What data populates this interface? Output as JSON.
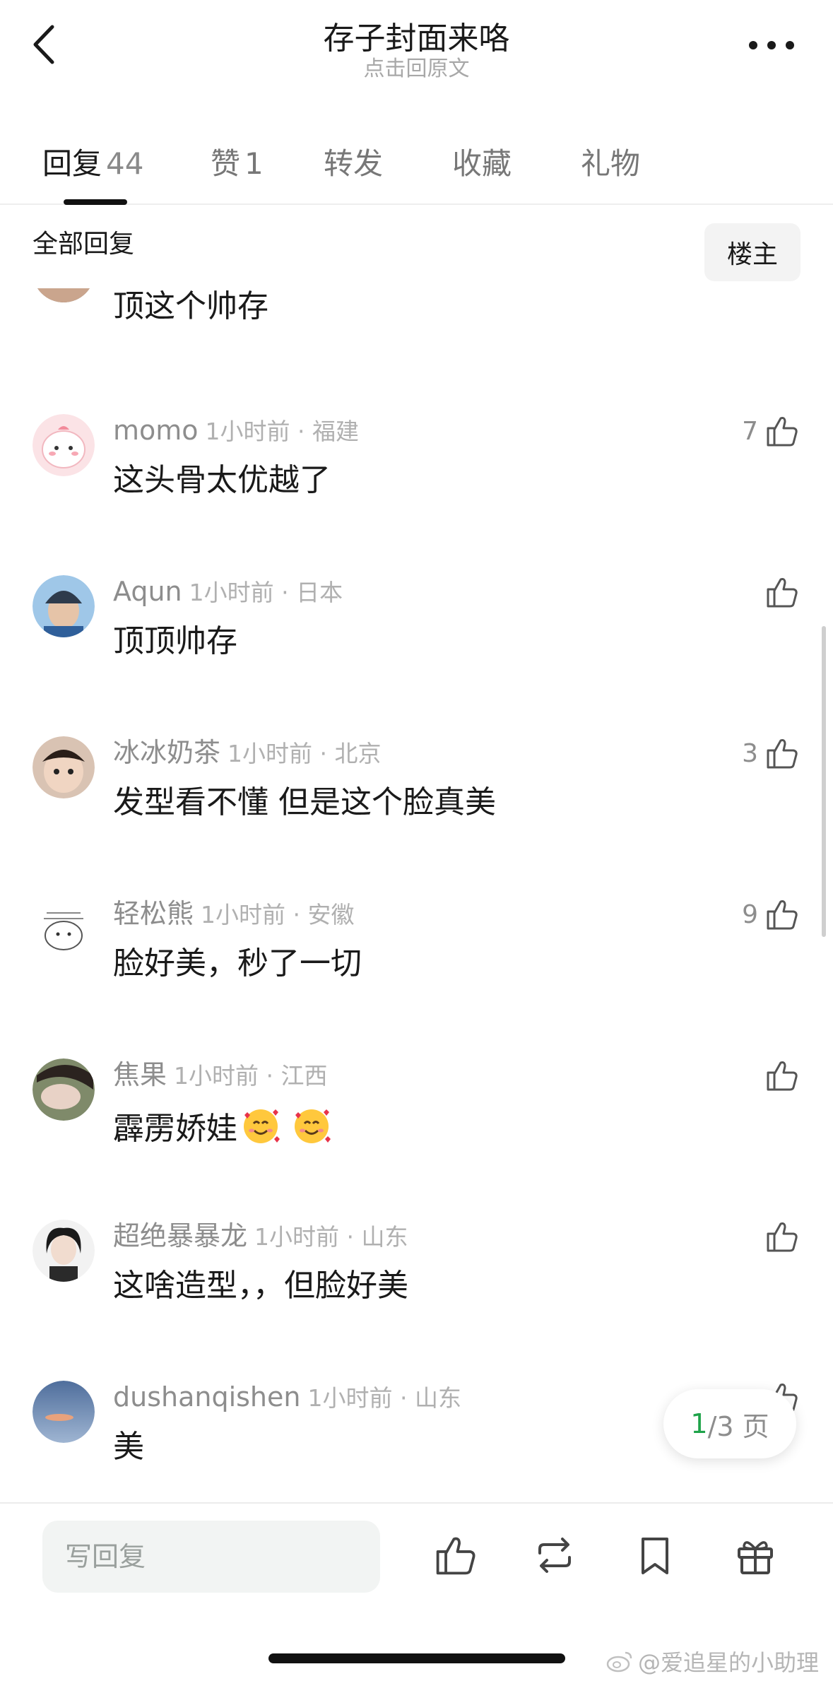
{
  "header": {
    "title": "存子封面来咯",
    "subtitle": "点击回原文"
  },
  "tabs": [
    {
      "label": "回复",
      "count": "44",
      "active": true
    },
    {
      "label": "赞",
      "count": "1",
      "active": false
    },
    {
      "label": "转发",
      "count": "",
      "active": false
    },
    {
      "label": "收藏",
      "count": "",
      "active": false
    },
    {
      "label": "礼物",
      "count": "",
      "active": false
    }
  ],
  "filter": {
    "label": "全部回复",
    "owner_button": "楼主"
  },
  "comments": [
    {
      "name": "",
      "meta": "",
      "text": "顶这个帅存",
      "likes": ""
    },
    {
      "name": "momo",
      "meta": "1小时前 · 福建",
      "text": "这头骨太优越了",
      "likes": "7"
    },
    {
      "name": "Aqun",
      "meta": "1小时前 · 日本",
      "text": "顶顶帅存",
      "likes": ""
    },
    {
      "name": "冰冰奶茶",
      "meta": "1小时前 · 北京",
      "text": "发型看不懂 但是这个脸真美",
      "likes": "3"
    },
    {
      "name": "轻松熊",
      "meta": "1小时前 · 安徽",
      "text": "脸好美，秒了一切",
      "likes": "9"
    },
    {
      "name": "焦果",
      "meta": "1小时前 · 江西",
      "text": "霹雳娇娃",
      "likes": ""
    },
    {
      "name": "超绝暴暴龙",
      "meta": "1小时前 · 山东",
      "text": "这啥造型，，但脸好美",
      "likes": ""
    },
    {
      "name": "dushanqishen",
      "meta": "1小时前 · 山东",
      "text": "美",
      "likes": ""
    }
  ],
  "page_indicator": {
    "current": "1",
    "rest": "/3 页"
  },
  "bottom_bar": {
    "reply_placeholder": "写回复"
  },
  "watermark": "@爱追星的小助理",
  "icons": {
    "back": "chevron-left-icon",
    "more": "more-dots-icon",
    "like": "thumbs-up-icon",
    "repost": "repost-icon",
    "bookmark": "bookmark-icon",
    "gift": "gift-icon",
    "weibo": "weibo-logo-icon"
  },
  "colors": {
    "accent_green": "#1fa34a",
    "muted_text": "#8d8d8d",
    "input_bg": "#f2f4f3"
  }
}
